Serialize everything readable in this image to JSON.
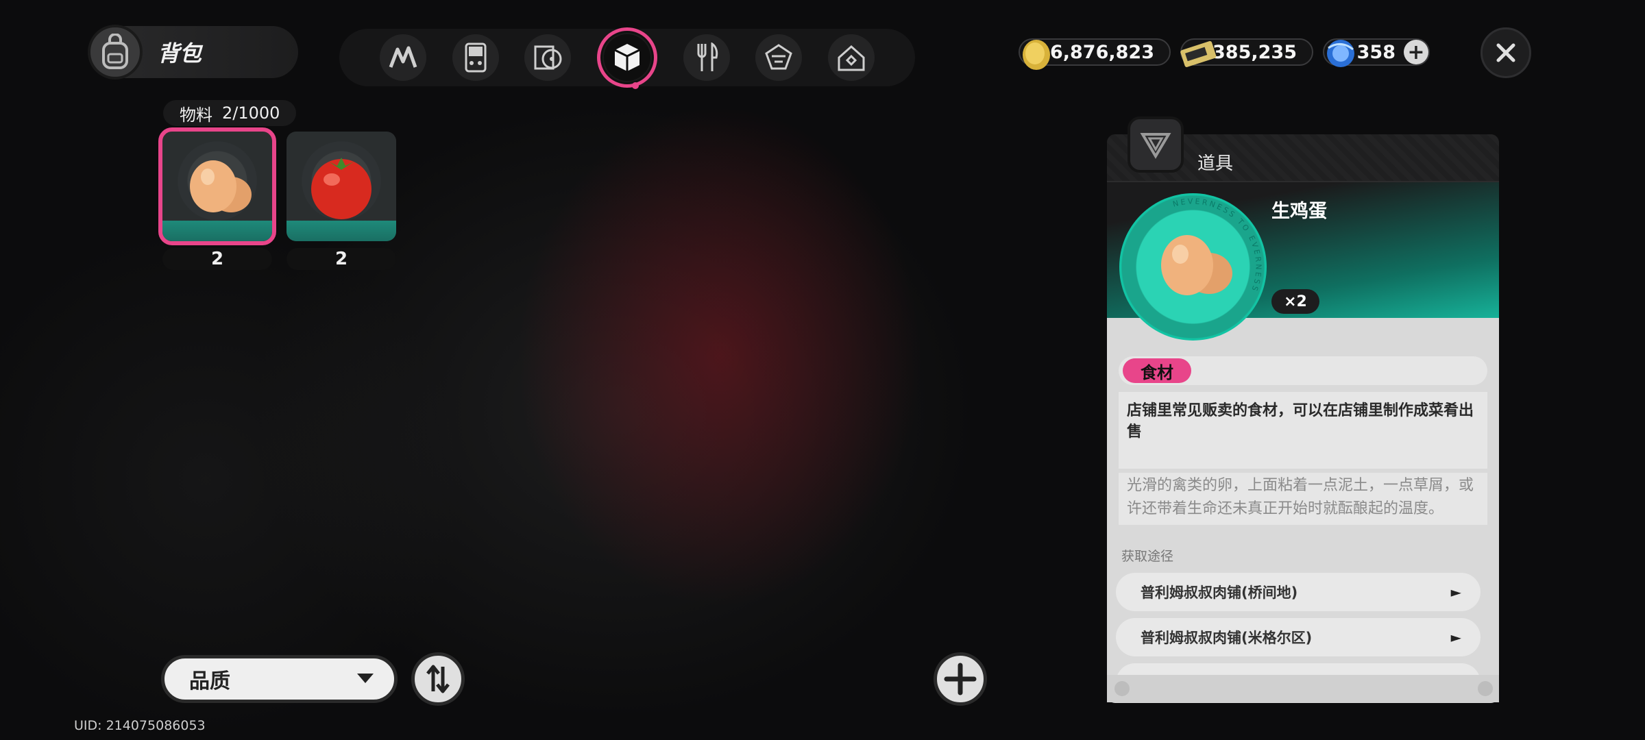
{
  "header": {
    "title": "背包"
  },
  "tabs": [
    {
      "icon": "agent-icon",
      "active": false
    },
    {
      "icon": "device-icon",
      "active": false
    },
    {
      "icon": "disc-icon",
      "active": false
    },
    {
      "icon": "cube-icon",
      "active": true
    },
    {
      "icon": "fork-knife-icon",
      "active": false
    },
    {
      "icon": "material-icon",
      "active": false
    },
    {
      "icon": "home-icon",
      "active": false
    }
  ],
  "currencies": {
    "coins": "6,876,823",
    "tickets": "385,235",
    "crystals": "358"
  },
  "inventory": {
    "category_label": "物料",
    "count": "2/1000",
    "items": [
      {
        "name": "egg-item",
        "qty": "2",
        "selected": true
      },
      {
        "name": "tomato-item",
        "qty": "2",
        "selected": false
      }
    ]
  },
  "detail": {
    "category": "道具",
    "name": "生鸡蛋",
    "multiplier": "×2",
    "tag": "食材",
    "description": "店铺里常见贩卖的食材，可以在店铺里制作成菜肴出售",
    "lore": "光滑的禽类的卵，上面粘着一点泥土，一点草屑，或许还带着生命还未真正开始时就酝酿起的温度。",
    "source_label": "获取途径",
    "sources": [
      "普利姆叔叔肉铺(桥间地)",
      "普利姆叔叔肉铺(米格尔区)"
    ],
    "ring_text": "NEVERNESS TO EVERNESS"
  },
  "controls": {
    "sort_label": "品质"
  },
  "uid": "UID: 214075086053",
  "colors": {
    "accent": "#e8458a",
    "teal": "#17b39a"
  }
}
